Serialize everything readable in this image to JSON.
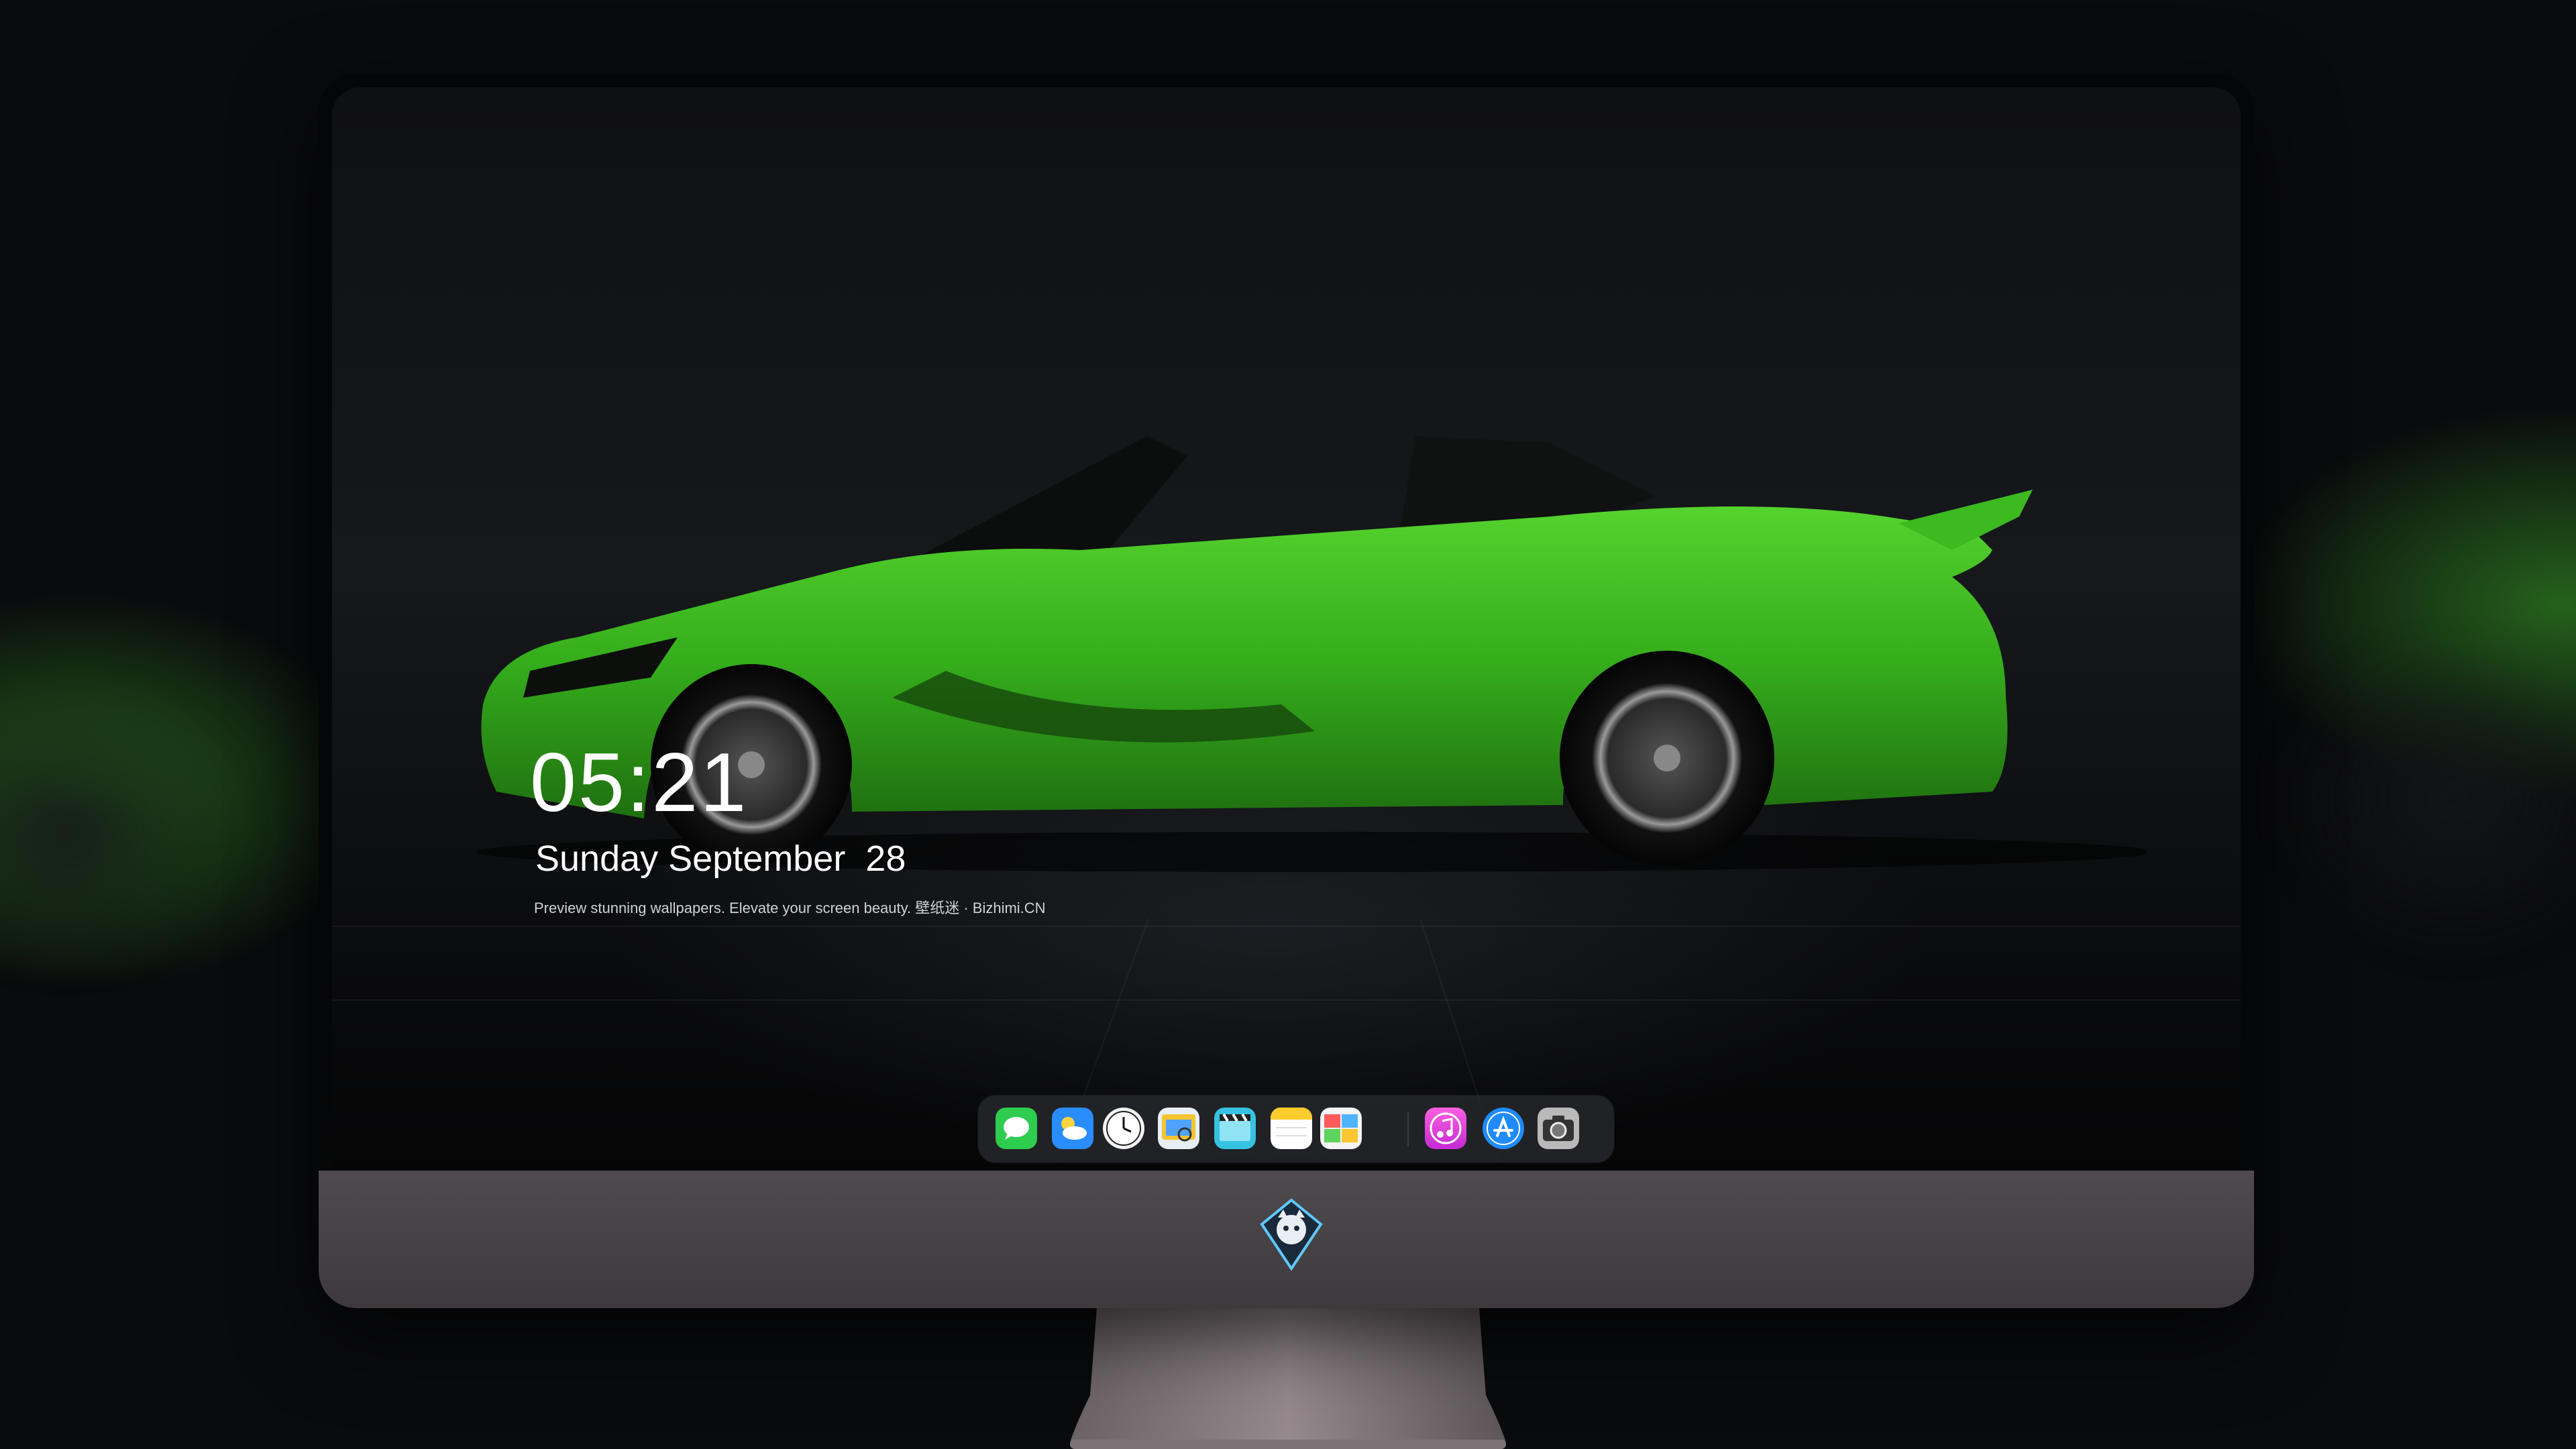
{
  "lock_screen": {
    "time": "05:21",
    "date": "Sunday September  28",
    "tagline": "Preview stunning wallpapers. Elevate your screen beauty. 壁纸迷 · Bizhimi.CN"
  },
  "dock": {
    "apps": [
      {
        "icon": "messages-icon",
        "color": "#2ecc4f"
      },
      {
        "icon": "weather-icon",
        "color": "#2a8dff"
      },
      {
        "icon": "clock-icon",
        "color": "#f2f2f2"
      },
      {
        "icon": "preview-icon",
        "color": "#f4c430"
      },
      {
        "icon": "video-editor-icon",
        "color": "#36c2e0"
      },
      {
        "icon": "notes-icon",
        "color": "#ffcc2e"
      },
      {
        "icon": "photos-icon",
        "color": "#4fb3ff"
      },
      {
        "icon": "music-icon",
        "color": "#e43fd6"
      },
      {
        "icon": "app-store-icon",
        "color": "#1f8bff"
      },
      {
        "icon": "camera-icon",
        "color": "#9a9a9a"
      }
    ]
  },
  "colors": {
    "car_body": "#39b81f",
    "background": "#0b0c0e",
    "chin": "#4a4548"
  },
  "monitor_logo": {
    "icon": "mascot-logo-icon"
  }
}
